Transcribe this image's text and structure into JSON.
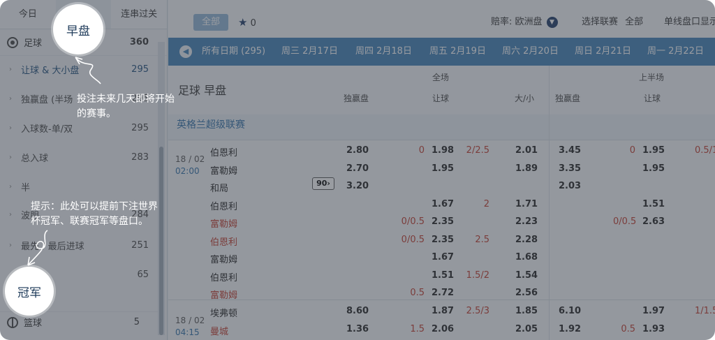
{
  "tabs": [
    {
      "label": "今日"
    },
    {
      "label": "早盘"
    },
    {
      "label": "连串过关"
    }
  ],
  "sidebar": {
    "sport_football": {
      "label": "足球",
      "count": "360"
    },
    "items": [
      {
        "label": "让球 & 大小盘",
        "count": "295"
      },
      {
        "label": "独赢盘 (半场",
        "count": "295"
      },
      {
        "label": "入球数-单/双",
        "count": "295"
      },
      {
        "label": "总入球",
        "count": "283"
      },
      {
        "label": "半",
        "count": ""
      },
      {
        "label": "波胆",
        "count": "284"
      },
      {
        "label": "最先 / 最后进球",
        "count": "251"
      },
      {
        "label": "",
        "count": "65"
      }
    ],
    "sport_basketball": {
      "label": "篮球",
      "count": "5"
    }
  },
  "filter": {
    "all_label": "全部",
    "favorites_count": "0",
    "odds_label": "赔率: 欧洲盘",
    "league_label": "选择联赛",
    "league_value": "全部",
    "single_label": "单线盘口显示"
  },
  "dates": {
    "all": "所有日期 (295)",
    "items": [
      "周三 2月17日",
      "周四 2月18日",
      "周五 2月19日",
      "周六 2月20日",
      "周日 2月21日",
      "周一 2月22日"
    ]
  },
  "header": {
    "title": "足球 早盘",
    "full_time": "全场",
    "half_time": "上半场",
    "col_1x2": "独赢盘",
    "col_hc": "让球",
    "col_ou": "大/小",
    "col_h1x2": "独赢盘",
    "col_hhc": "让球"
  },
  "league": "英格兰超级联赛",
  "match1": {
    "date": "18 / 02",
    "time": "02:00",
    "more": "90",
    "rows": [
      {
        "team": "伯恩利",
        "p1x2": "2.80",
        "hc": "0",
        "hco": "1.98",
        "ou": "2/2.5",
        "ouo": "2.01",
        "h1x2": "3.45",
        "hhc": "0",
        "hhco": "1.95",
        "hou": "0.5/1"
      },
      {
        "team": "富勒姆",
        "p1x2": "2.70",
        "hc": "",
        "hco": "1.95",
        "ou": "",
        "ouo": "1.89",
        "h1x2": "3.35",
        "hhc": "",
        "hhco": "1.95",
        "hou": ""
      },
      {
        "team": "和局",
        "p1x2": "3.20",
        "hc": "",
        "hco": "",
        "ou": "",
        "ouo": "",
        "h1x2": "2.03",
        "hhc": "",
        "hhco": "",
        "hou": ""
      },
      {
        "team": "伯恩利",
        "p1x2": "",
        "hc": "",
        "hco": "1.67",
        "ou": "2",
        "ouo": "1.71",
        "h1x2": "",
        "hhc": "",
        "hhco": "1.51",
        "hou": ""
      },
      {
        "team": "富勒姆",
        "p1x2": "",
        "hc": "0/0.5",
        "hco": "2.35",
        "ou": "",
        "ouo": "2.23",
        "h1x2": "",
        "hhc": "0/0.5",
        "hhco": "2.63",
        "hou": ""
      },
      {
        "team": "伯恩利",
        "p1x2": "",
        "hc": "0/0.5",
        "hco": "2.35",
        "ou": "2.5",
        "ouo": "2.28",
        "h1x2": "",
        "hhc": "",
        "hhco": "",
        "hou": ""
      },
      {
        "team": "富勒姆",
        "p1x2": "",
        "hc": "",
        "hco": "1.67",
        "ou": "",
        "ouo": "1.68",
        "h1x2": "",
        "hhc": "",
        "hhco": "",
        "hou": ""
      },
      {
        "team": "伯恩利",
        "p1x2": "",
        "hc": "",
        "hco": "1.51",
        "ou": "1.5/2",
        "ouo": "1.54",
        "h1x2": "",
        "hhc": "",
        "hhco": "",
        "hou": ""
      },
      {
        "team": "富勒姆",
        "p1x2": "",
        "hc": "0.5",
        "hco": "2.72",
        "ou": "",
        "ouo": "2.56",
        "h1x2": "",
        "hhc": "",
        "hhco": "",
        "hou": ""
      }
    ]
  },
  "match2": {
    "date": "18 / 02",
    "time": "04:15",
    "rows": [
      {
        "team": "埃弗顿",
        "p1x2": "8.60",
        "hc": "",
        "hco": "1.87",
        "ou": "2.5/3",
        "ouo": "1.85",
        "h1x2": "6.10",
        "hhc": "",
        "hhco": "1.97",
        "hou": "1/1.5"
      },
      {
        "team": "曼城",
        "p1x2": "1.36",
        "hc": "1.5",
        "hco": "2.06",
        "ou": "",
        "ouo": "2.05",
        "h1x2": "1.92",
        "hhc": "0.5",
        "hhco": "1.93",
        "hou": ""
      }
    ]
  },
  "overlay": {
    "early_circle": "早盘",
    "early_tip_1": "投注未来几天即将开始",
    "early_tip_2": "的赛事。",
    "champion_circle": "冠军",
    "champion_tip_1": "提示：此处可以提前下注世界",
    "champion_tip_2": "杯冠军、联赛冠军等盘口。"
  }
}
